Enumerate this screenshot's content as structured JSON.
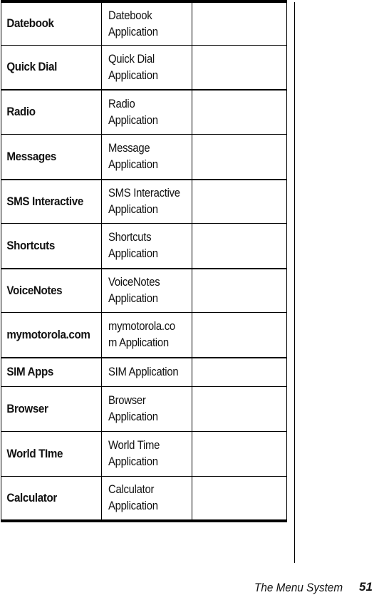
{
  "table": {
    "rows": [
      {
        "name": "Datebook",
        "description": "Datebook\nApplication",
        "notes": ""
      },
      {
        "name": "Quick Dial",
        "description": "Quick Dial\nApplication",
        "notes": ""
      },
      {
        "name": "Radio",
        "description": "Radio\nApplication",
        "notes": ""
      },
      {
        "name": "Messages",
        "description": "Message\nApplication",
        "notes": ""
      },
      {
        "name": "SMS Interactive",
        "description": "SMS Interactive\nApplication",
        "notes": ""
      },
      {
        "name": "Shortcuts",
        "description": "Shortcuts\nApplication",
        "notes": ""
      },
      {
        "name": "VoiceNotes",
        "description": "VoiceNotes\nApplication",
        "notes": ""
      },
      {
        "name": "mymotorola.com",
        "description": "mymotorola.co\nm Application",
        "notes": ""
      },
      {
        "name": "SIM Apps",
        "description": "SIM Application",
        "notes": ""
      },
      {
        "name": "Browser",
        "description": "Browser\nApplication",
        "notes": ""
      },
      {
        "name": "World TIme",
        "description": "World Time\nApplication",
        "notes": ""
      },
      {
        "name": "Calculator",
        "description": "Calculator\nApplication",
        "notes": ""
      }
    ]
  },
  "footer": {
    "section_title": "The Menu System",
    "page_number": "51"
  }
}
